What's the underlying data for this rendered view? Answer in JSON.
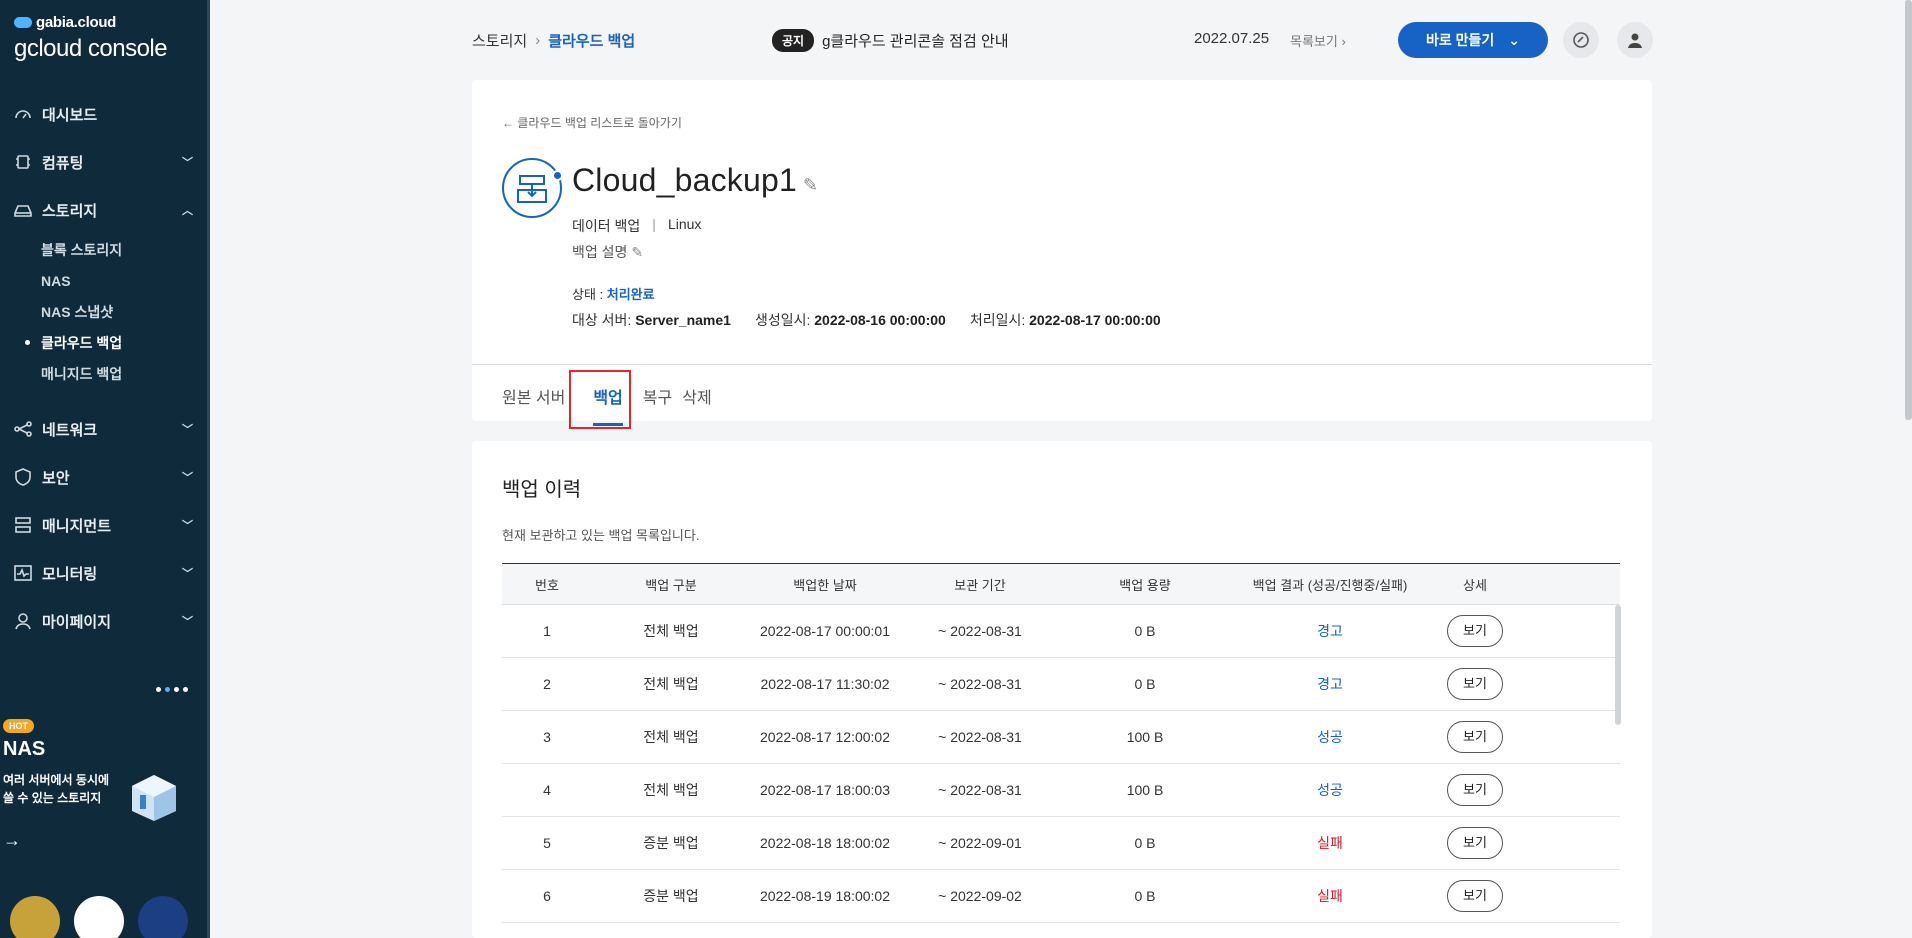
{
  "logo": {
    "brand": "gabia.cloud",
    "product": "gcloud console"
  },
  "sidebar": {
    "items": [
      {
        "label": "대시보드",
        "icon": "dashboard-icon"
      },
      {
        "label": "컴퓨팅",
        "icon": "cpu-icon"
      },
      {
        "label": "스토리지",
        "icon": "storage-icon"
      },
      {
        "label": "네트워크",
        "icon": "network-icon"
      },
      {
        "label": "보안",
        "icon": "shield-icon"
      },
      {
        "label": "매니지먼트",
        "icon": "management-icon"
      },
      {
        "label": "모니터링",
        "icon": "monitor-icon"
      },
      {
        "label": "마이페이지",
        "icon": "user-icon"
      }
    ],
    "storage_sub": [
      "블록 스토리지",
      "NAS",
      "NAS 스냅샷",
      "클라우드 백업",
      "매니지드 백업"
    ]
  },
  "promo": {
    "tag": "HOT",
    "title": "NAS",
    "desc": "여러 서버에서 동시에 쓸 수 있는 스토리지",
    "arrow": "→"
  },
  "breadcrumb": {
    "parent": "스토리지",
    "sep": "›",
    "current": "클라우드 백업"
  },
  "notice": {
    "tag": "공지",
    "text": "g클라우드 관리콘솔 점검 안내",
    "date": "2022.07.25",
    "more": "목록보기 ›"
  },
  "header": {
    "create_label": "바로 만들기"
  },
  "detail": {
    "back_label": "← 클라우드 백업 리스트로 돌아가기",
    "title": "Cloud_backup1",
    "type": "데이터 백업",
    "os": "Linux",
    "desc_label": "백업 설명",
    "status_label": "상태 : ",
    "status_value": "처리완료",
    "server_label": "대상 서버: ",
    "server_value": "Server_name1",
    "created_label": "생성일시: ",
    "created_value": "2022-08-16 00:00:00",
    "processed_label": "처리일시: ",
    "processed_value": "2022-08-17 00:00:00"
  },
  "tabs": [
    "원본 서버",
    "백업",
    "복구",
    "삭제"
  ],
  "history": {
    "title": "백업 이력",
    "desc": "현재 보관하고 있는 백업 목록입니다.",
    "columns": [
      "번호",
      "백업 구분",
      "백업한 날짜",
      "보관 기간",
      "백업 용량",
      "백업 결과 (성공/진행중/실패)",
      "상세"
    ],
    "rows": [
      {
        "no": "1",
        "kind": "전체 백업",
        "date": "2022-08-17 00:00:01",
        "period": "~ 2022-08-31",
        "size": "0 B",
        "result": "경고",
        "status": "ok",
        "detail": "보기"
      },
      {
        "no": "2",
        "kind": "전체 백업",
        "date": "2022-08-17 11:30:02",
        "period": "~ 2022-08-31",
        "size": "0 B",
        "result": "경고",
        "status": "ok",
        "detail": "보기"
      },
      {
        "no": "3",
        "kind": "전체 백업",
        "date": "2022-08-17 12:00:02",
        "period": "~ 2022-08-31",
        "size": "100 B",
        "result": "성공",
        "status": "ok",
        "detail": "보기"
      },
      {
        "no": "4",
        "kind": "전체 백업",
        "date": "2022-08-17 18:00:03",
        "period": "~ 2022-08-31",
        "size": "100 B",
        "result": "성공",
        "status": "ok",
        "detail": "보기"
      },
      {
        "no": "5",
        "kind": "증분 백업",
        "date": "2022-08-18 18:00:02",
        "period": "~ 2022-09-01",
        "size": "0 B",
        "result": "실패",
        "status": "fail",
        "detail": "보기"
      },
      {
        "no": "6",
        "kind": "증분 백업",
        "date": "2022-08-19 18:00:02",
        "period": "~ 2022-09-02",
        "size": "0 B",
        "result": "실패",
        "status": "fail",
        "detail": "보기"
      }
    ]
  },
  "colors": {
    "sidebar_bg": "#0f2a3b",
    "accent": "#1762c5",
    "fail": "#d7192a",
    "highlight": "#e8252b"
  }
}
